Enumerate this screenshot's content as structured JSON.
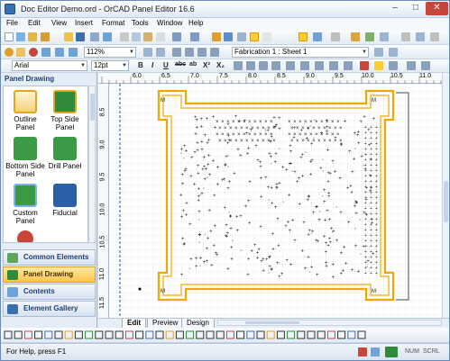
{
  "window": {
    "title": "Doc Editor Demo.ord - OrCAD Panel Editor 16.6",
    "buttons": {
      "minimize": "–",
      "maximize": "□",
      "close": "✕"
    }
  },
  "menu": [
    "File",
    "Edit",
    "View",
    "Insert",
    "Format",
    "Tools",
    "Window",
    "Help"
  ],
  "toolbar2": {
    "zoom_value": "112%",
    "sheet_value": "Fabrication 1 : Sheet 1"
  },
  "toolbar3": {
    "font_value": "Arial",
    "size_value": "12pt",
    "format_buttons": [
      "B",
      "I",
      "U",
      "abc",
      "ab",
      "X²",
      "X₂"
    ]
  },
  "left_panel": {
    "header": "Panel Drawing",
    "items": [
      {
        "label": "Outline Panel",
        "icon": "outline-panel-icon"
      },
      {
        "label": "Top Side Panel",
        "icon": "top-side-panel-icon"
      },
      {
        "label": "Bottom Side Panel",
        "icon": "bottom-side-panel-icon"
      },
      {
        "label": "Drill Panel",
        "icon": "drill-panel-icon"
      },
      {
        "label": "Custom Panel",
        "icon": "custom-panel-icon"
      },
      {
        "label": "Fiducial",
        "icon": "fiducial-icon"
      }
    ],
    "nav": [
      {
        "label": "Common Elements",
        "active": false
      },
      {
        "label": "Panel Drawing",
        "active": true
      },
      {
        "label": "Contents",
        "active": false
      },
      {
        "label": "Element Gallery",
        "active": false
      }
    ]
  },
  "ruler": {
    "top_ticks": [
      "6.0",
      "6.5",
      "7.0",
      "7.5",
      "8.0",
      "8.5",
      "9.0",
      "9.5",
      "10.0",
      "10.5",
      "11.0"
    ],
    "left_ticks": [
      "8.5",
      "9.0",
      "9.5",
      "10.0",
      "10.5",
      "11.0",
      "11.5"
    ]
  },
  "tabs": [
    "Edit",
    "Preview",
    "Design"
  ],
  "status": {
    "message": "For Help, press F1",
    "indicators": [
      "NUM",
      "SCRL"
    ]
  },
  "colors": {
    "accent": "#ffc64a",
    "board_outline": "#f0a800",
    "titlebar_close": "#c7463a"
  }
}
